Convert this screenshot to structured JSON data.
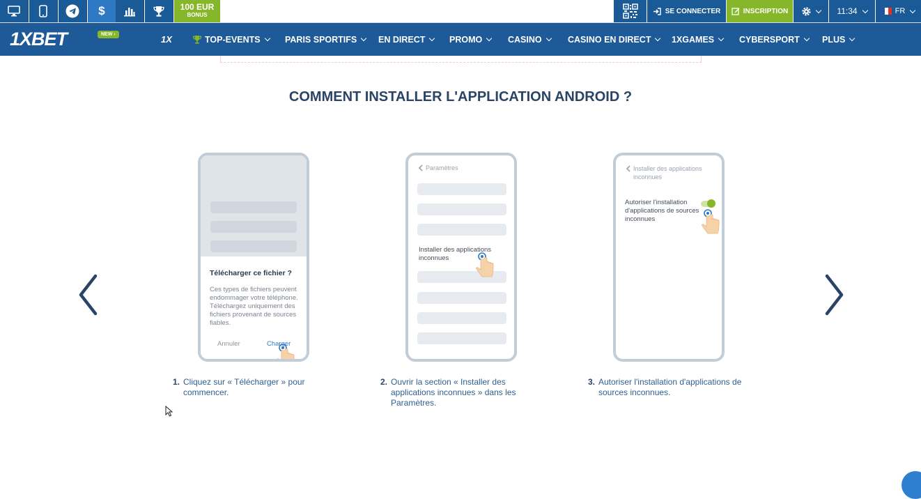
{
  "topbar": {
    "bonus_amount": "100 EUR",
    "bonus_label": "BONUS",
    "login_label": "SE CONNECTER",
    "register_label": "INSCRIPTION",
    "time": "11:34",
    "language": "FR"
  },
  "nav": {
    "logo_main": "1XBET",
    "new_badge": "NEW",
    "onex_label": "1X",
    "items": [
      "TOP-EVENTS",
      "PARIS SPORTIFS",
      "EN DIRECT",
      "PROMO",
      "CASINO",
      "CASINO EN DIRECT",
      "1XGAMES",
      "CYBERSPORT",
      "PLUS"
    ]
  },
  "page": {
    "title": "COMMENT INSTALLER L'APPLICATION ANDROID ?"
  },
  "phones": {
    "p1": {
      "dialog_title": "Télécharger ce fichier ?",
      "dialog_body": "Ces types de fichiers peuvent endommager votre téléphone. Téléchargez uniquement des fichiers provenant de sources fiables.",
      "cancel": "Annuler",
      "confirm": "Charger"
    },
    "p2": {
      "back_label": "Paramètres",
      "highlight": "Installer des applications inconnues"
    },
    "p3": {
      "back_label": "Installer des applications inconnues",
      "toggle_label": "Autoriser l'installation d'applications de sources inconnues"
    }
  },
  "steps": [
    {
      "num": "1.",
      "text": "Cliquez sur « Télécharger » pour commencer."
    },
    {
      "num": "2.",
      "text": "Ouvrir la section « Installer des applications inconnues » dans les Paramètres."
    },
    {
      "num": "3.",
      "text": "Autoriser l'installation d'applications de sources inconnues."
    }
  ],
  "colors": {
    "brand_blue": "#1d5a97",
    "accent_green": "#86b72a",
    "title": "#2a4466"
  }
}
